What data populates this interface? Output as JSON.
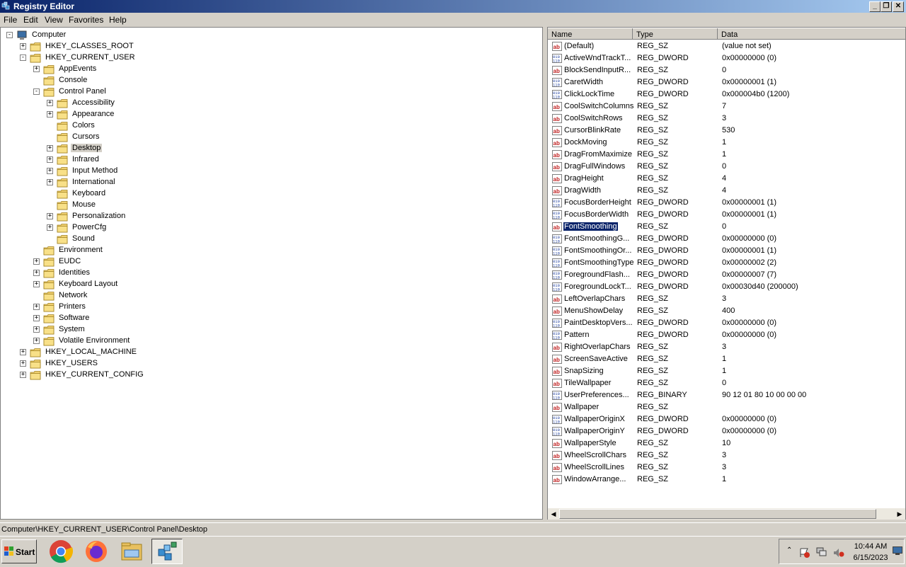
{
  "window": {
    "title": "Registry Editor",
    "controls": {
      "minimize": "_",
      "restore": "❐",
      "close": "✕"
    }
  },
  "menu": [
    "File",
    "Edit",
    "View",
    "Favorites",
    "Help"
  ],
  "tree": [
    {
      "label": "Computer",
      "level": 0,
      "expander": "-",
      "icon": "computer-icon"
    },
    {
      "label": "HKEY_CLASSES_ROOT",
      "level": 1,
      "expander": "+",
      "icon": "folder-icon"
    },
    {
      "label": "HKEY_CURRENT_USER",
      "level": 1,
      "expander": "-",
      "icon": "folder-icon"
    },
    {
      "label": "AppEvents",
      "level": 2,
      "expander": "+",
      "icon": "folder-icon"
    },
    {
      "label": "Console",
      "level": 2,
      "expander": "",
      "icon": "folder-icon"
    },
    {
      "label": "Control Panel",
      "level": 2,
      "expander": "-",
      "icon": "folder-icon"
    },
    {
      "label": "Accessibility",
      "level": 3,
      "expander": "+",
      "icon": "folder-icon"
    },
    {
      "label": "Appearance",
      "level": 3,
      "expander": "+",
      "icon": "folder-icon"
    },
    {
      "label": "Colors",
      "level": 3,
      "expander": "",
      "icon": "folder-icon"
    },
    {
      "label": "Cursors",
      "level": 3,
      "expander": "",
      "icon": "folder-icon"
    },
    {
      "label": "Desktop",
      "level": 3,
      "expander": "+",
      "icon": "folder-icon",
      "selected": true
    },
    {
      "label": "Infrared",
      "level": 3,
      "expander": "+",
      "icon": "folder-icon"
    },
    {
      "label": "Input Method",
      "level": 3,
      "expander": "+",
      "icon": "folder-icon"
    },
    {
      "label": "International",
      "level": 3,
      "expander": "+",
      "icon": "folder-icon"
    },
    {
      "label": "Keyboard",
      "level": 3,
      "expander": "",
      "icon": "folder-icon"
    },
    {
      "label": "Mouse",
      "level": 3,
      "expander": "",
      "icon": "folder-icon"
    },
    {
      "label": "Personalization",
      "level": 3,
      "expander": "+",
      "icon": "folder-icon"
    },
    {
      "label": "PowerCfg",
      "level": 3,
      "expander": "+",
      "icon": "folder-icon"
    },
    {
      "label": "Sound",
      "level": 3,
      "expander": "",
      "icon": "folder-icon"
    },
    {
      "label": "Environment",
      "level": 2,
      "expander": "",
      "icon": "folder-icon"
    },
    {
      "label": "EUDC",
      "level": 2,
      "expander": "+",
      "icon": "folder-icon"
    },
    {
      "label": "Identities",
      "level": 2,
      "expander": "+",
      "icon": "folder-icon"
    },
    {
      "label": "Keyboard Layout",
      "level": 2,
      "expander": "+",
      "icon": "folder-icon"
    },
    {
      "label": "Network",
      "level": 2,
      "expander": "",
      "icon": "folder-icon"
    },
    {
      "label": "Printers",
      "level": 2,
      "expander": "+",
      "icon": "folder-icon"
    },
    {
      "label": "Software",
      "level": 2,
      "expander": "+",
      "icon": "folder-icon"
    },
    {
      "label": "System",
      "level": 2,
      "expander": "+",
      "icon": "folder-icon"
    },
    {
      "label": "Volatile Environment",
      "level": 2,
      "expander": "+",
      "icon": "folder-icon"
    },
    {
      "label": "HKEY_LOCAL_MACHINE",
      "level": 1,
      "expander": "+",
      "icon": "folder-icon"
    },
    {
      "label": "HKEY_USERS",
      "level": 1,
      "expander": "+",
      "icon": "folder-icon"
    },
    {
      "label": "HKEY_CURRENT_CONFIG",
      "level": 1,
      "expander": "+",
      "icon": "folder-icon"
    }
  ],
  "values_header": {
    "name": "Name",
    "type": "Type",
    "data": "Data"
  },
  "values": [
    {
      "name": "(Default)",
      "type": "REG_SZ",
      "data": "(value not set)",
      "icon": "string-value-icon"
    },
    {
      "name": "ActiveWndTrackT...",
      "type": "REG_DWORD",
      "data": "0x00000000 (0)",
      "icon": "binary-value-icon"
    },
    {
      "name": "BlockSendInputR...",
      "type": "REG_SZ",
      "data": "0",
      "icon": "string-value-icon"
    },
    {
      "name": "CaretWidth",
      "type": "REG_DWORD",
      "data": "0x00000001 (1)",
      "icon": "binary-value-icon"
    },
    {
      "name": "ClickLockTime",
      "type": "REG_DWORD",
      "data": "0x000004b0 (1200)",
      "icon": "binary-value-icon"
    },
    {
      "name": "CoolSwitchColumns",
      "type": "REG_SZ",
      "data": "7",
      "icon": "string-value-icon"
    },
    {
      "name": "CoolSwitchRows",
      "type": "REG_SZ",
      "data": "3",
      "icon": "string-value-icon"
    },
    {
      "name": "CursorBlinkRate",
      "type": "REG_SZ",
      "data": "530",
      "icon": "string-value-icon"
    },
    {
      "name": "DockMoving",
      "type": "REG_SZ",
      "data": "1",
      "icon": "string-value-icon"
    },
    {
      "name": "DragFromMaximize",
      "type": "REG_SZ",
      "data": "1",
      "icon": "string-value-icon"
    },
    {
      "name": "DragFullWindows",
      "type": "REG_SZ",
      "data": "0",
      "icon": "string-value-icon"
    },
    {
      "name": "DragHeight",
      "type": "REG_SZ",
      "data": "4",
      "icon": "string-value-icon"
    },
    {
      "name": "DragWidth",
      "type": "REG_SZ",
      "data": "4",
      "icon": "string-value-icon"
    },
    {
      "name": "FocusBorderHeight",
      "type": "REG_DWORD",
      "data": "0x00000001 (1)",
      "icon": "binary-value-icon"
    },
    {
      "name": "FocusBorderWidth",
      "type": "REG_DWORD",
      "data": "0x00000001 (1)",
      "icon": "binary-value-icon"
    },
    {
      "name": "FontSmoothing",
      "type": "REG_SZ",
      "data": "0",
      "icon": "string-value-icon",
      "selected": true
    },
    {
      "name": "FontSmoothingG...",
      "type": "REG_DWORD",
      "data": "0x00000000 (0)",
      "icon": "binary-value-icon"
    },
    {
      "name": "FontSmoothingOr...",
      "type": "REG_DWORD",
      "data": "0x00000001 (1)",
      "icon": "binary-value-icon"
    },
    {
      "name": "FontSmoothingType",
      "type": "REG_DWORD",
      "data": "0x00000002 (2)",
      "icon": "binary-value-icon"
    },
    {
      "name": "ForegroundFlash...",
      "type": "REG_DWORD",
      "data": "0x00000007 (7)",
      "icon": "binary-value-icon"
    },
    {
      "name": "ForegroundLockT...",
      "type": "REG_DWORD",
      "data": "0x00030d40 (200000)",
      "icon": "binary-value-icon"
    },
    {
      "name": "LeftOverlapChars",
      "type": "REG_SZ",
      "data": "3",
      "icon": "string-value-icon"
    },
    {
      "name": "MenuShowDelay",
      "type": "REG_SZ",
      "data": "400",
      "icon": "string-value-icon"
    },
    {
      "name": "PaintDesktopVers...",
      "type": "REG_DWORD",
      "data": "0x00000000 (0)",
      "icon": "binary-value-icon"
    },
    {
      "name": "Pattern",
      "type": "REG_DWORD",
      "data": "0x00000000 (0)",
      "icon": "binary-value-icon"
    },
    {
      "name": "RightOverlapChars",
      "type": "REG_SZ",
      "data": "3",
      "icon": "string-value-icon"
    },
    {
      "name": "ScreenSaveActive",
      "type": "REG_SZ",
      "data": "1",
      "icon": "string-value-icon"
    },
    {
      "name": "SnapSizing",
      "type": "REG_SZ",
      "data": "1",
      "icon": "string-value-icon"
    },
    {
      "name": "TileWallpaper",
      "type": "REG_SZ",
      "data": "0",
      "icon": "string-value-icon"
    },
    {
      "name": "UserPreferences...",
      "type": "REG_BINARY",
      "data": "90 12 01 80 10 00 00 00",
      "icon": "binary-value-icon"
    },
    {
      "name": "Wallpaper",
      "type": "REG_SZ",
      "data": "",
      "icon": "string-value-icon"
    },
    {
      "name": "WallpaperOriginX",
      "type": "REG_DWORD",
      "data": "0x00000000 (0)",
      "icon": "binary-value-icon"
    },
    {
      "name": "WallpaperOriginY",
      "type": "REG_DWORD",
      "data": "0x00000000 (0)",
      "icon": "binary-value-icon"
    },
    {
      "name": "WallpaperStyle",
      "type": "REG_SZ",
      "data": "10",
      "icon": "string-value-icon"
    },
    {
      "name": "WheelScrollChars",
      "type": "REG_SZ",
      "data": "3",
      "icon": "string-value-icon"
    },
    {
      "name": "WheelScrollLines",
      "type": "REG_SZ",
      "data": "3",
      "icon": "string-value-icon"
    },
    {
      "name": "WindowArrange...",
      "type": "REG_SZ",
      "data": "1",
      "icon": "string-value-icon"
    }
  ],
  "status": {
    "path": "Computer\\HKEY_CURRENT_USER\\Control Panel\\Desktop"
  },
  "taskbar": {
    "start_label": "Start",
    "apps": [
      "chrome-icon",
      "firefox-icon",
      "file-explorer-icon",
      "regedit-icon"
    ],
    "time": "10:44 AM",
    "date": "6/15/2023"
  },
  "colors": {
    "title_start": "#0a246a",
    "title_end": "#a6caf0",
    "selection": "#0a246a",
    "folder": "#f0d070"
  }
}
